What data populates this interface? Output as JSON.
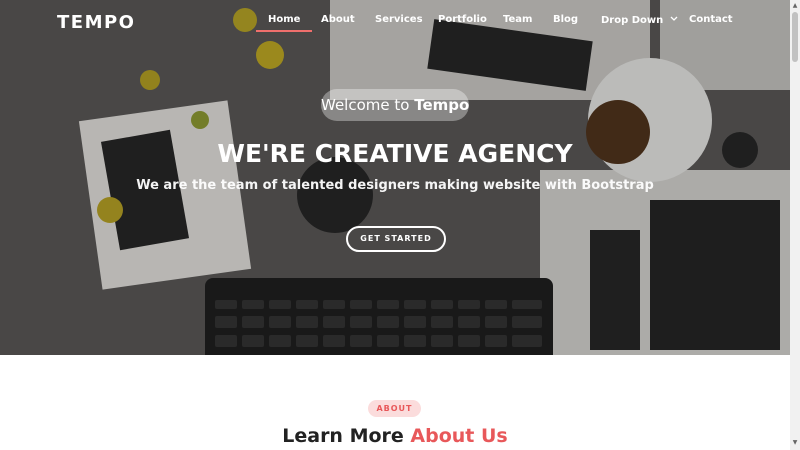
{
  "brand": {
    "logo": "TEMPO"
  },
  "nav": {
    "items": [
      {
        "label": "Home",
        "active": true
      },
      {
        "label": "About"
      },
      {
        "label": "Services"
      },
      {
        "label": "Portfolio"
      },
      {
        "label": "Team"
      },
      {
        "label": "Blog"
      },
      {
        "label": "Drop Down",
        "has_dropdown": true
      },
      {
        "label": "Contact"
      }
    ]
  },
  "hero": {
    "welcome_prefix": "Welcome to",
    "welcome_brand": "Tempo",
    "headline": "WE'RE CREATIVE AGENCY",
    "subline": "We are the team of talented designers making website with Bootstrap",
    "cta_label": "GET STARTED"
  },
  "about": {
    "badge": "ABOUT",
    "title_prefix": "Learn More",
    "title_accent": "About Us"
  },
  "colors": {
    "accent": "#e8585a",
    "badge_bg": "#fbdcdc",
    "nav_underline": "#ef6f6c"
  },
  "icons": {
    "dropdown": "chevron-down-icon",
    "scroll_up": "arrow-up-icon",
    "scroll_down": "arrow-down-icon"
  }
}
